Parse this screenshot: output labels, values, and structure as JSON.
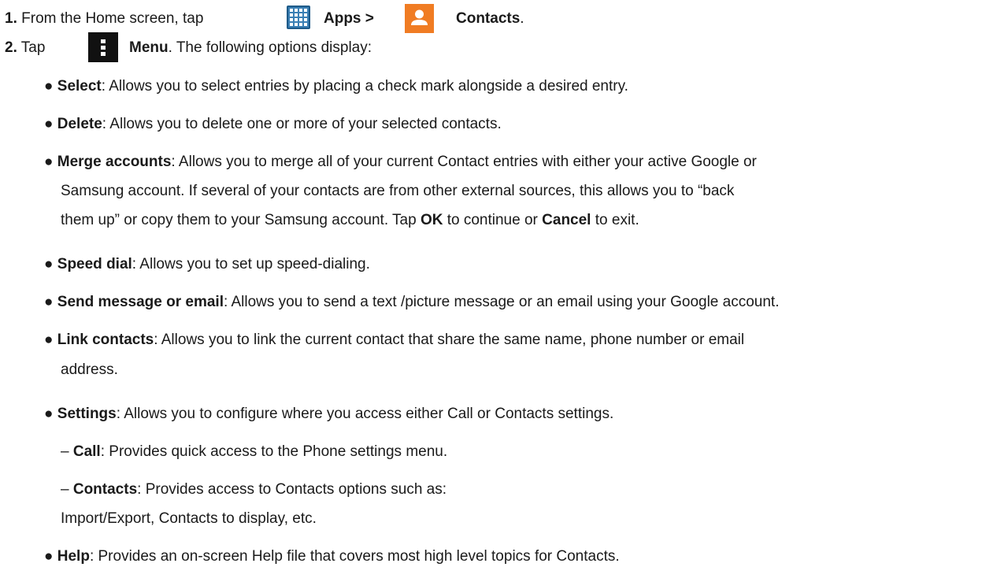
{
  "step1": {
    "num": "1.",
    "pre": "From the Home screen, tap",
    "apps": "Apps >",
    "contacts": "Contacts",
    "period": "."
  },
  "step2": {
    "num": "2.",
    "pre": "Tap",
    "menu": "Menu",
    "post": ". The following options display:"
  },
  "bullets": {
    "select": {
      "term": "Select",
      "desc": ": Allows you to select entries by placing a check mark alongside a desired entry."
    },
    "delete": {
      "term": "Delete",
      "desc": ": Allows you to delete one or more of your selected contacts."
    },
    "merge": {
      "term": "Merge accounts",
      "desc1": ": Allows you to merge all of your current Contact entries with either your active Google or",
      "desc2": "Samsung account. If several of your contacts are from other external sources, this allows you to “back",
      "desc3": "them up” or copy them to your Samsung account. Tap ",
      "ok": "OK",
      "mid": " to continue or ",
      "cancel": "Cancel",
      "end": " to exit."
    },
    "speed": {
      "term": "Speed dial",
      "desc": ": Allows you to set up speed-dialing."
    },
    "send": {
      "term": "Send message or email",
      "desc": ": Allows you to send a text /picture message or an email using your Google account."
    },
    "link": {
      "term": "Link contacts",
      "desc1": ": Allows you to link the current contact that share the same name, phone number or email",
      "desc2": "address."
    },
    "settings": {
      "term": "Settings",
      "desc": ": Allows you to configure where you access either Call or Contacts settings."
    },
    "help": {
      "term": "Help",
      "desc": ": Provides an on-screen Help file that covers most high level topics for Contacts."
    }
  },
  "subitems": {
    "call": {
      "term": "Call",
      "desc": ": Provides quick access to the Phone settings menu."
    },
    "contacts": {
      "term": "Contacts",
      "desc1": ": Provides access to Contacts options such as:",
      "desc2": "Import/Export, Contacts to display, etc."
    }
  },
  "glyphs": {
    "bullet": "●",
    "dash": "–"
  },
  "colors": {
    "apps_icon": "#3a7fb4",
    "contacts_icon": "#f07c23",
    "menu_icon": "#111111"
  },
  "icons": {
    "apps": "apps-grid-icon",
    "contacts": "contacts-person-icon",
    "menu": "menu-icon"
  }
}
